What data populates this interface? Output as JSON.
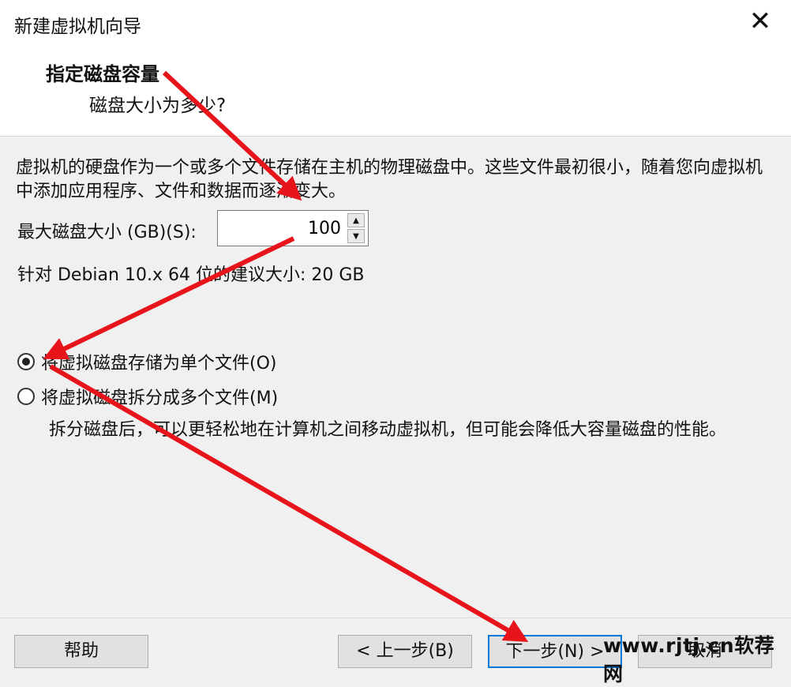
{
  "window": {
    "title": "新建虚拟机向导",
    "close_icon": "close-icon"
  },
  "header": {
    "title": "指定磁盘容量",
    "subtitle": "磁盘大小为多少?"
  },
  "description": "虚拟机的硬盘作为一个或多个文件存储在主机的物理磁盘中。这些文件最初很小，随着您向虚拟机中添加应用程序、文件和数据而逐渐变大。",
  "disk_size": {
    "label": "最大磁盘大小 (GB)(S):",
    "value": "100"
  },
  "recommendation": "针对 Debian 10.x 64 位的建议大小: 20 GB",
  "options": [
    {
      "label": "将虚拟磁盘存储为单个文件(O)",
      "checked": true
    },
    {
      "label": "将虚拟磁盘拆分成多个文件(M)",
      "checked": false
    }
  ],
  "split_description": "拆分磁盘后，可以更轻松地在计算机之间移动虚拟机，但可能会降低大容量磁盘的性能。",
  "buttons": {
    "help": "帮助",
    "back": "< 上一步(B)",
    "next": "下一步(N) >",
    "cancel": "取消"
  },
  "watermark": "www.rjtj.cn软荐网",
  "colors": {
    "arrow": "#e8141b",
    "default_button_border": "#0078d7"
  }
}
